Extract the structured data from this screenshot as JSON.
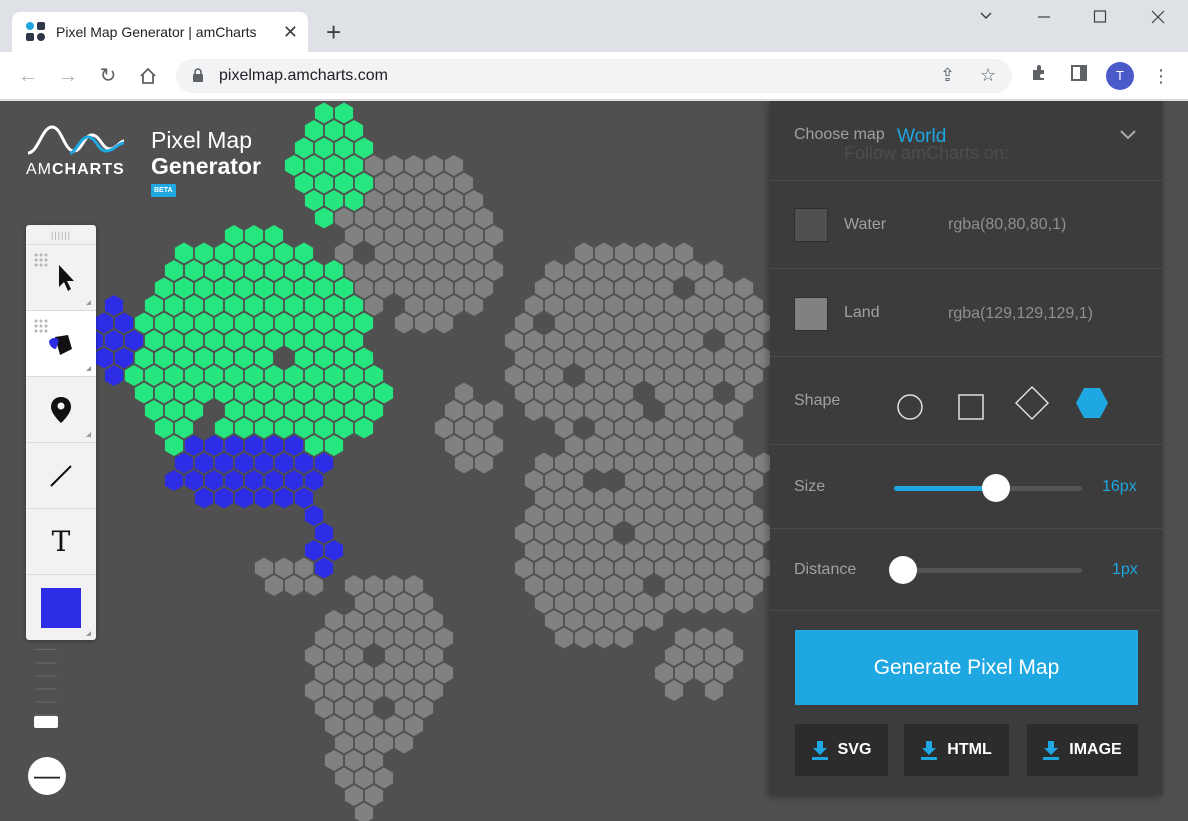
{
  "browser": {
    "tab_title": "Pixel Map Generator | amCharts",
    "url": "pixelmap.amcharts.com",
    "avatar_initial": "T"
  },
  "app": {
    "logo_brand_light": "AM",
    "logo_brand_bold": "CHARTS",
    "title_line1": "Pixel Map",
    "title_line2": "Generator",
    "beta": "BETA",
    "water_color": "#505050",
    "land_color": "#818181",
    "highlight_colors": [
      "#26e67f",
      "#2d2de8"
    ]
  },
  "toolbox": {
    "tools": [
      {
        "name": "select-tool",
        "icon": "cursor-icon"
      },
      {
        "name": "fill-tool",
        "icon": "paint-bucket-icon"
      },
      {
        "name": "marker-tool",
        "icon": "map-pin-icon"
      },
      {
        "name": "line-tool",
        "icon": "line-icon"
      },
      {
        "name": "text-tool",
        "icon": "text-icon",
        "label": "T"
      },
      {
        "name": "color-tool",
        "icon": "color-swatch-icon"
      }
    ],
    "selected_color": "#2d2de8",
    "zoom_out_label": "—"
  },
  "panel": {
    "choose_map_label": "Choose map",
    "choose_map_value": "World",
    "ghost_text": "Follow amCharts on:",
    "water_label": "Water",
    "water_value": "rgba(80,80,80,1)",
    "land_label": "Land",
    "land_value": "rgba(129,129,129,1)",
    "shape_label": "Shape",
    "shapes": [
      "circle",
      "square",
      "diamond",
      "hexagon"
    ],
    "selected_shape": "hexagon",
    "size_label": "Size",
    "size_value": "16px",
    "size_fraction": 0.54,
    "distance_label": "Distance",
    "distance_value": "1px",
    "distance_fraction": 0.05,
    "generate_label": "Generate Pixel Map",
    "downloads": [
      "SVG",
      "HTML",
      "IMAGE"
    ],
    "accent": "#1ea7e1"
  }
}
